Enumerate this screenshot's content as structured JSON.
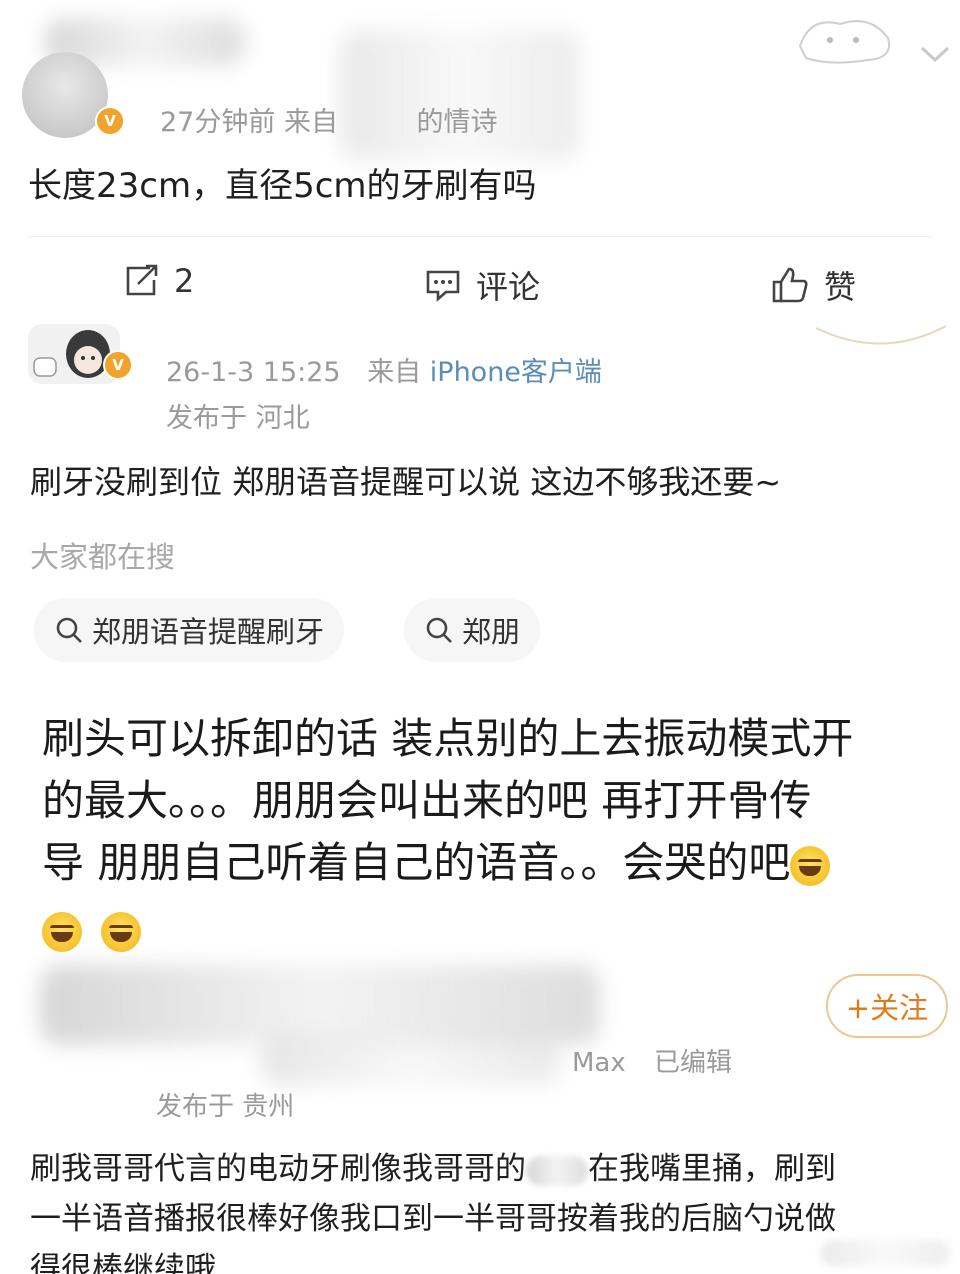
{
  "post": {
    "meta": "27分钟前 来自",
    "source_suffix": "的情诗",
    "content": "长度23cm，直径5cm的牙刷有吗"
  },
  "actions": {
    "repost_count": "2",
    "comment_label": "评论",
    "like_label": "赞"
  },
  "comment1": {
    "date": "26-1-3 15:25",
    "from_label": "来自",
    "client": "iPhone客户端",
    "location": "发布于 河北",
    "content": "刷牙没刷到位 郑朋语音提醒可以说 这边不够我还要~"
  },
  "search": {
    "heading": "大家都在搜",
    "chips": [
      "郑朋语音提醒刷牙",
      "郑朋"
    ]
  },
  "reply": {
    "line1": "刷头可以拆卸的话 装点别的上去振动模式开",
    "line2": "的最大。。。朋朋会叫出来的吧 再打开骨传",
    "line3": "导 朋朋自己听着自己的语音。。会哭的吧"
  },
  "comment2": {
    "follow_label": "+关注",
    "device_suffix": "Max",
    "edited_label": "已编辑",
    "location": "发布于 贵州",
    "line1_a": "刷我哥哥代言的电动牙刷像我哥哥的",
    "line1_b": "在我嘴里捅，刷到",
    "line2": "一半语音播报很棒好像我口到一半哥哥按着我的后脑勺说做",
    "line3": "得很棒继续哦"
  },
  "colors": {
    "badge": "#f2a32b",
    "follow": "#e07a1a",
    "muted": "#9a9a9a",
    "client_blue": "#5b8db8"
  },
  "icons": [
    "verified-badge-icon",
    "repost-icon",
    "comment-icon",
    "like-icon",
    "search-icon",
    "laugh-emoji-icon",
    "chevron-down-icon"
  ]
}
